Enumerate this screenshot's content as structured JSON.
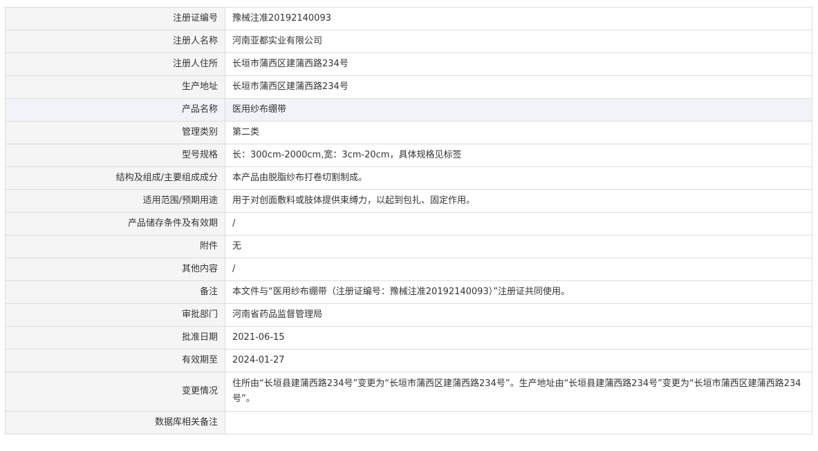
{
  "rows": [
    {
      "label": "注册证编号",
      "value": "豫械注准20192140093"
    },
    {
      "label": "注册人名称",
      "value": "河南亚都实业有限公司"
    },
    {
      "label": "注册人住所",
      "value": "长垣市蒲西区建蒲西路234号"
    },
    {
      "label": "生产地址",
      "value": "长垣市蒲西区建蒲西路234号"
    },
    {
      "label": "产品名称",
      "value": "医用纱布绷带"
    },
    {
      "label": "管理类别",
      "value": "第二类"
    },
    {
      "label": "型号规格",
      "value": "长：300cm-2000cm,宽：3cm-20cm，具体规格见标签"
    },
    {
      "label": "结构及组成/主要组成成分",
      "value": "本产品由脱脂纱布打卷切割制成。"
    },
    {
      "label": "适用范围/预期用途",
      "value": "用于对创面敷料或肢体提供束缚力，以起到包扎、固定作用。"
    },
    {
      "label": "产品储存条件及有效期",
      "value": "/"
    },
    {
      "label": "附件",
      "value": "无"
    },
    {
      "label": "其他内容",
      "value": "/"
    },
    {
      "label": "备注",
      "value": "本文件与“医用纱布绷带（注册证编号：豫械注准20192140093）”注册证共同使用。"
    },
    {
      "label": "审批部门",
      "value": "河南省药品监督管理局"
    },
    {
      "label": "批准日期",
      "value": "2021-06-15"
    },
    {
      "label": "有效期至",
      "value": "2024-01-27"
    },
    {
      "label": "变更情况",
      "value": "住所由“长垣县建蒲西路234号”变更为“长垣市蒲西区建蒲西路234号”。生产地址由“长垣县建蒲西路234号”变更为“长垣市蒲西区建蒲西路234号”。"
    },
    {
      "label": "数据库相关备注",
      "value": ""
    }
  ]
}
